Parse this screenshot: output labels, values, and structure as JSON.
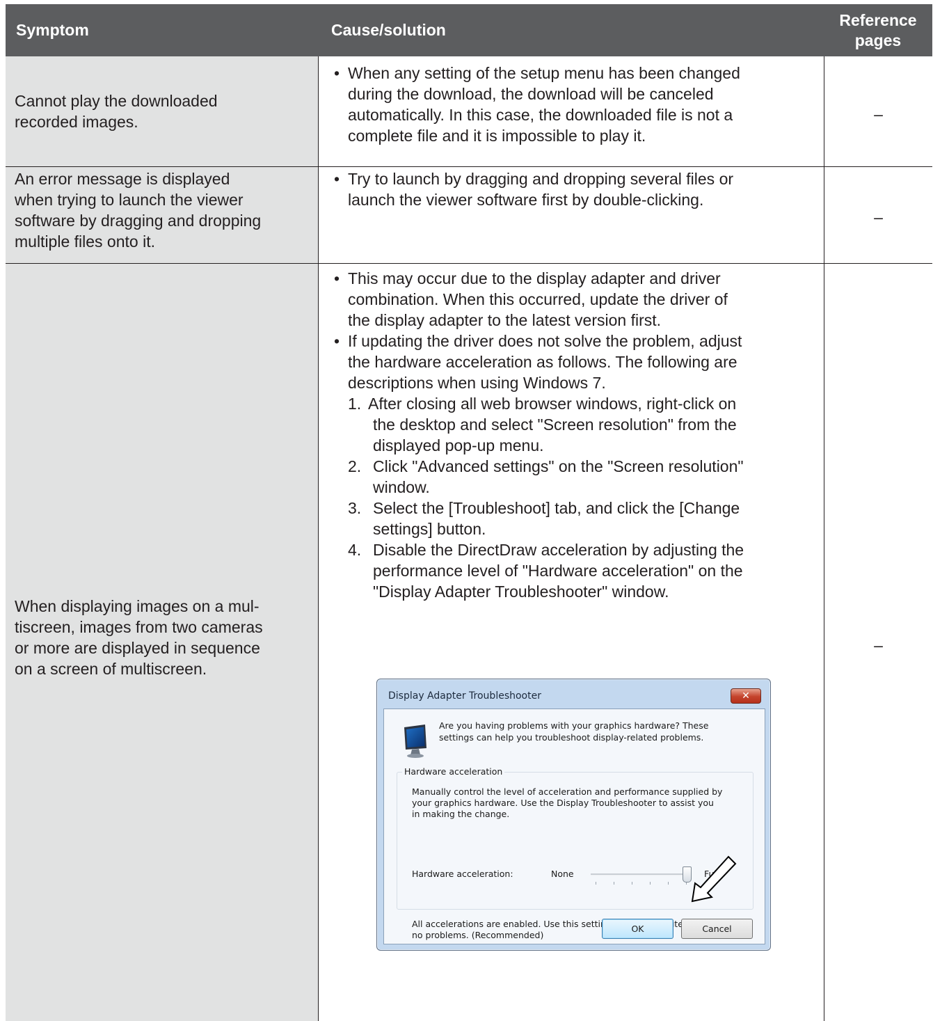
{
  "header": {
    "symptom": "Symptom",
    "cause": "Cause/solution",
    "reference_line1": "Reference",
    "reference_line2": "pages"
  },
  "rows": [
    {
      "symptom_lines": [
        "Cannot play the downloaded",
        "recorded images."
      ],
      "cause_lines": [
        "When any setting of the setup menu has been changed",
        "during the download, the download will be canceled",
        "automatically. In this case, the downloaded file is not a",
        "complete file and it is impossible to play it."
      ],
      "reference": "–"
    },
    {
      "symptom_lines": [
        "An error message is displayed",
        "when trying to launch the viewer",
        "software by dragging and dropping",
        "multiple files onto it."
      ],
      "cause_lines": [
        "Try to launch by dragging and dropping several files or",
        "launch the viewer software first by double-clicking."
      ],
      "reference": "–"
    },
    {
      "symptom_lines": [
        "When displaying images on a mul-",
        "tiscreen, images from two cameras",
        "or more are displayed in sequence",
        "on a screen of multiscreen."
      ],
      "bullet1_lines": [
        "This may occur due to the display adapter and driver",
        "combination. When this occurred, update the driver of",
        "the display adapter to the latest version first."
      ],
      "bullet2_lines": [
        "If updating the driver does not solve the problem, adjust",
        "the hardware acceleration as follows. The following are",
        "descriptions when using Windows 7."
      ],
      "steps": [
        {
          "num": "1.",
          "lines": [
            " After closing all web browser windows, right-click on",
            "the desktop and select \"Screen resolution\" from the",
            "displayed pop-up menu."
          ]
        },
        {
          "num": "2.",
          "lines": [
            "Click \"Advanced settings\" on the \"Screen resolution\"",
            "window."
          ]
        },
        {
          "num": "3.",
          "lines": [
            "Select the [Troubleshoot] tab, and click the [Change",
            "settings] button."
          ]
        },
        {
          "num": "4.",
          "lines": [
            "Disable the DirectDraw acceleration by adjusting the",
            "performance level of \"Hardware acceleration\" on the",
            "\"Display Adapter Troubleshooter\" window."
          ]
        }
      ],
      "reference": "–"
    }
  ],
  "dialog": {
    "title": "Display Adapter Troubleshooter",
    "close_glyph": "✕",
    "intro_line1": "Are you having problems with your graphics hardware? These",
    "intro_line2": "settings can help you troubleshoot display-related problems.",
    "group_label": "Hardware acceleration",
    "group_desc_line1": "Manually control the level of acceleration and performance supplied by",
    "group_desc_line2": "your graphics hardware. Use the Display Troubleshooter to assist you",
    "group_desc_line3": "in making the change.",
    "slider_label": "Hardware acceleration:",
    "slider_min": "None",
    "slider_max": "Full",
    "slider_level": 1.0,
    "status_line1": "All accelerations are enabled. Use this setting if your computer has",
    "status_line2": "no problems. (Recommended)",
    "ok": "OK",
    "cancel": "Cancel",
    "icons": [
      "monitor-icon",
      "pointer-arrow-icon",
      "close-icon"
    ]
  }
}
